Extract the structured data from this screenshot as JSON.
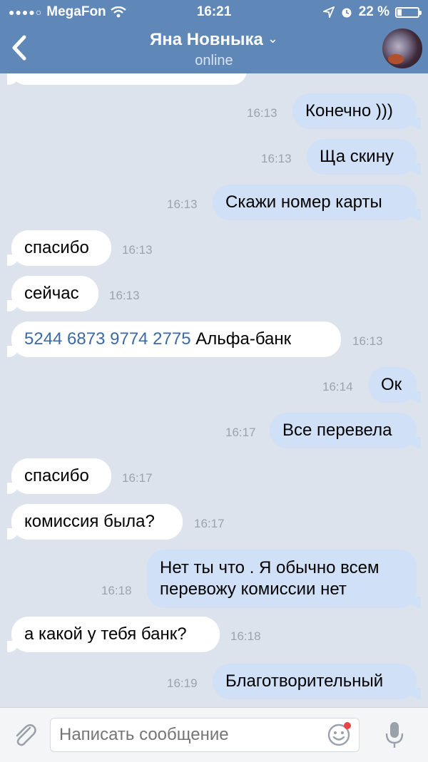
{
  "status_bar": {
    "signal_dots": "●●●●○",
    "carrier": "MegaFon",
    "time": "16:21",
    "battery_percent": "22 %",
    "battery_level": 0.22
  },
  "header": {
    "contact_name": "Яна Новныка",
    "presence": "online"
  },
  "messages": [
    {
      "dir": "in",
      "text": "",
      "time": ""
    },
    {
      "dir": "out",
      "text": "Конечно )))",
      "time": "16:13"
    },
    {
      "dir": "out",
      "text": "Ща скину",
      "time": "16:13"
    },
    {
      "dir": "out",
      "text": "Скажи номер карты",
      "time": "16:13"
    },
    {
      "dir": "in",
      "text": "спасибо",
      "time": "16:13"
    },
    {
      "dir": "in",
      "text": "сейчас",
      "time": "16:13"
    },
    {
      "dir": "in",
      "card": "5244 6873 9774 2775",
      "text": "Альфа-банк",
      "time": "16:13"
    },
    {
      "dir": "out",
      "text": "Ок",
      "time": "16:14"
    },
    {
      "dir": "out",
      "text": "Все перевела",
      "time": "16:17"
    },
    {
      "dir": "in",
      "text": "спасибо",
      "time": "16:17"
    },
    {
      "dir": "in",
      "text": "комиссия была?",
      "time": "16:17"
    },
    {
      "dir": "out",
      "line1": "Нет ты что . Я обычно всем",
      "line2": "перевожу комиссии нет",
      "time": "16:18"
    },
    {
      "dir": "in",
      "text": "а какой у тебя банк?",
      "time": "16:18"
    },
    {
      "dir": "out",
      "text": "Благотворительный",
      "time": "16:19"
    }
  ],
  "composer": {
    "placeholder": "Написать сообщение"
  },
  "colors": {
    "header": "#5f87b7",
    "outgoing_bubble": "#cfe0f7",
    "incoming_bubble": "#ffffff",
    "background": "#dde3ec",
    "link": "#3d6aa6",
    "notification_dot": "#e64646"
  }
}
